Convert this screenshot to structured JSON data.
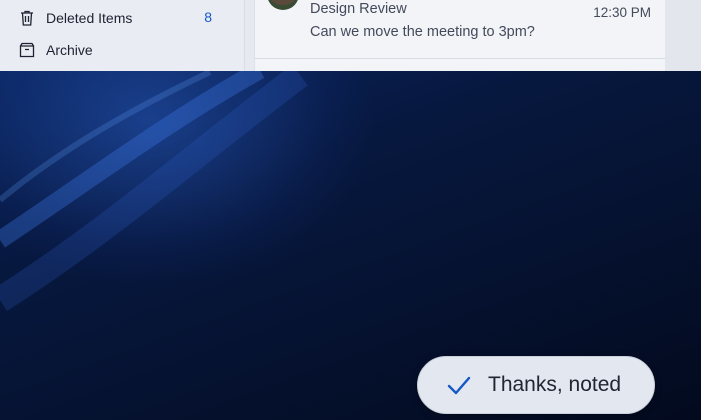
{
  "folders": [
    {
      "label": "Deleted Items",
      "count": "8",
      "icon": "trash-icon"
    },
    {
      "label": "Archive",
      "count": "",
      "icon": "archive-icon"
    }
  ],
  "message": {
    "subject": "Design Review",
    "time": "12:30 PM",
    "preview": "Can we move the meeting to 3pm?"
  },
  "toast": {
    "label": "Thanks, noted",
    "icon": "checkmark-icon"
  },
  "colors": {
    "accent": "#1758c7",
    "wallpaper": "#07183f",
    "toast_bg": "#e3e7ef"
  }
}
